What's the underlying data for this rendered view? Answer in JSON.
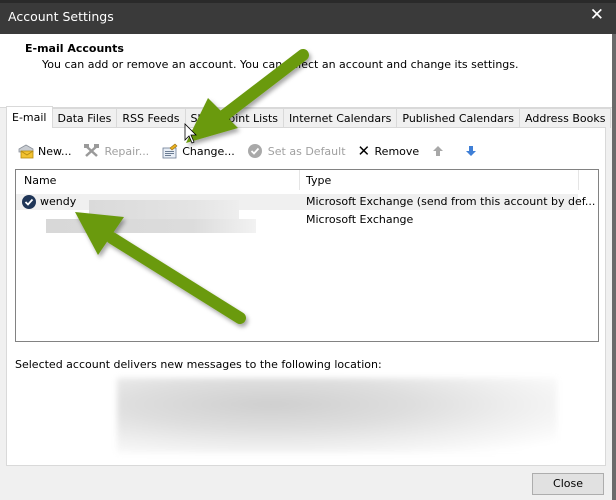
{
  "window": {
    "title": "Account Settings",
    "close_glyph": "✕"
  },
  "header": {
    "title": "E-mail Accounts",
    "description": "You can add or remove an account. You can select an account and change its settings."
  },
  "tabs": [
    {
      "label": "E-mail",
      "active": true
    },
    {
      "label": "Data Files",
      "active": false
    },
    {
      "label": "RSS Feeds",
      "active": false
    },
    {
      "label": "SharePoint Lists",
      "active": false
    },
    {
      "label": "Internet Calendars",
      "active": false
    },
    {
      "label": "Published Calendars",
      "active": false
    },
    {
      "label": "Address Books",
      "active": false
    }
  ],
  "toolbar": {
    "new_label": "New...",
    "repair_label": "Repair...",
    "change_label": "Change...",
    "set_default_label": "Set as Default",
    "remove_label": "Remove",
    "remove_glyph": "✕",
    "move_up_glyph": "▲",
    "move_down_glyph": "▼"
  },
  "accounts_list": {
    "columns": {
      "name": "Name",
      "type": "Type"
    },
    "rows": [
      {
        "name": "wendy",
        "type": "Microsoft Exchange (send from this account by def...",
        "selected": true,
        "default": true
      },
      {
        "name": "",
        "type": "Microsoft Exchange",
        "selected": false,
        "default": false
      }
    ]
  },
  "delivery": {
    "label": "Selected account delivers new messages to the following location:"
  },
  "footer": {
    "close_label": "Close"
  },
  "annotations": {
    "arrow_color": "#6a9a10",
    "arrows": [
      "points-to-change-button",
      "points-to-wendy-account"
    ]
  }
}
